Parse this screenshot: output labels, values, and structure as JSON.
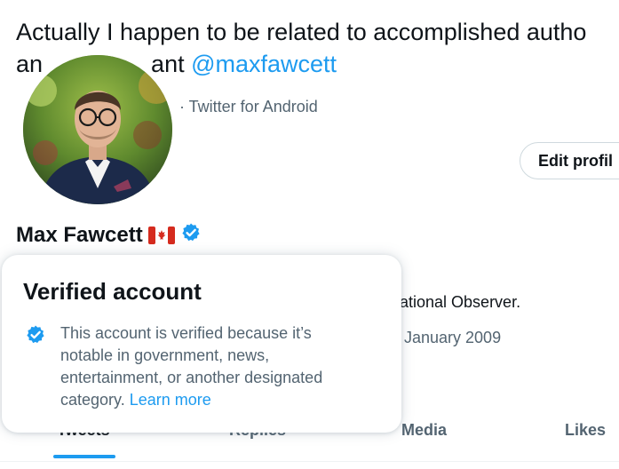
{
  "tweet": {
    "text_line1": "Actually I happen to be related to accomplished autho",
    "text_line2_prefix": "an",
    "text_line2_partial": "ant ",
    "mention": "@maxfawcett",
    "meta": "· Twitter for Android"
  },
  "profile": {
    "edit_button": "Edit profil",
    "name": "Max Fawcett",
    "bio_partial": "lational Observer.",
    "joined_partial": "l January 2009"
  },
  "tabs": [
    "Tweets",
    "Replies",
    "Media",
    "Likes"
  ],
  "popup": {
    "title": "Verified account",
    "body": "This account is verified because it’s notable in government, news, entertainment, or another designated category.",
    "link": "Learn more"
  },
  "colors": {
    "accent": "#1d9bf0",
    "text": "#0f1419",
    "muted": "#536471"
  },
  "icons": [
    "verified-badge-icon",
    "canada-flag-icon"
  ]
}
